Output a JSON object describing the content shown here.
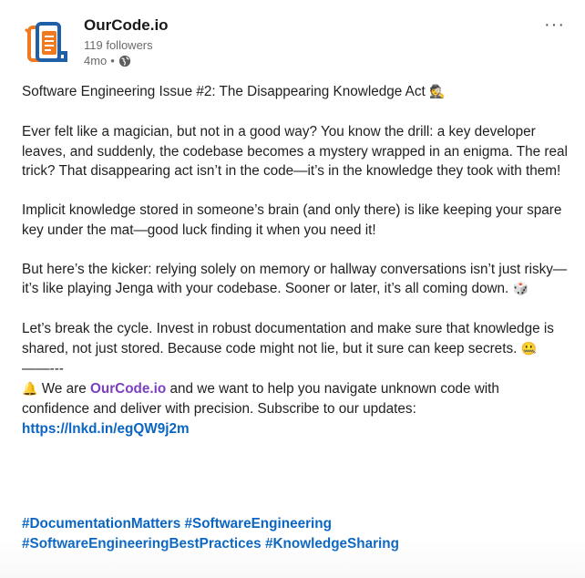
{
  "author": {
    "name": "OurCode.io",
    "followers": "119 followers",
    "time": "4mo",
    "separator": "•",
    "visibility_icon": "globe-icon"
  },
  "menu": {
    "more_label": "···"
  },
  "post": {
    "title": "Software Engineering Issue #2: The Disappearing Knowledge Act",
    "title_emoji": "🕵",
    "para1": "Ever felt like a magician, but not in a good way? You know the drill: a key developer leaves, and suddenly, the codebase becomes a mystery wrapped in an enigma. The real trick? That disappearing act isn’t in the code—it’s in the knowledge they took with them!",
    "para2": "Implicit knowledge stored in someone’s brain (and only there) is like keeping your spare key under the mat—good luck finding it when you need it!",
    "para3": "But here’s the kicker: relying solely on memory or hallway conversations isn’t just risky—it’s like playing Jenga with your codebase. Sooner or later, it’s all coming down.",
    "para3_emoji": "🎲",
    "para4": "Let’s break the cycle. Invest in robust documentation and make sure that knowledge is shared, not just stored. Because code might not lie, but it sure can keep secrets.",
    "para4_emoji": "🤐",
    "divider": "——---",
    "cta_emoji": "🔔",
    "cta_prefix": "We are",
    "cta_brand": "OurCode.io",
    "cta_middle": "and we want to help you navigate unknown code with confidence and deliver with precision. Subscribe to our updates:",
    "cta_link": "https://lnkd.in/egQW9j2m"
  },
  "hashtags": [
    "#DocumentationMatters",
    "#SoftwareEngineering",
    "#SoftwareEngineeringBestPractices",
    "#KnowledgeSharing"
  ],
  "colors": {
    "link": "#0a66c2",
    "brand": "#7b3fbf",
    "logo_orange": "#f07a21",
    "logo_blue": "#1e5fa8"
  }
}
